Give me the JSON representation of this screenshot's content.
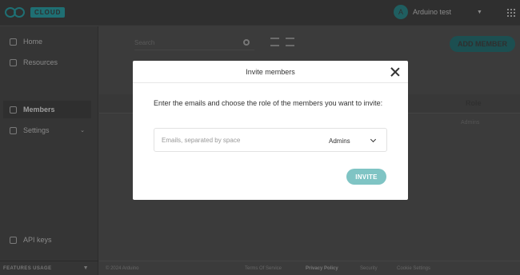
{
  "topbar": {
    "logo_text": "CLOUD",
    "user_initial": "A",
    "user_name": "Arduino test"
  },
  "sidebar": {
    "items": [
      {
        "label": "Home",
        "icon": "home-icon"
      },
      {
        "label": "Resources",
        "icon": "resources-icon"
      },
      {
        "label": "Members",
        "icon": "person-icon"
      },
      {
        "label": "Settings",
        "icon": "gear-icon"
      },
      {
        "label": "API keys",
        "icon": "key-icon"
      }
    ],
    "features_label": "FEATURES USAGE"
  },
  "main": {
    "search_placeholder": "Search",
    "add_member_label": "ADD MEMBER",
    "role_column": "Role",
    "role_value": "Admins"
  },
  "footer": {
    "copyright": "© 2024 Arduino",
    "terms": "Terms Of Service",
    "privacy": "Privacy Policy",
    "security": "Security",
    "cookie": "Cookie Settings"
  },
  "modal": {
    "title": "Invite members",
    "description": "Enter the emails and choose the role of the members you want to invite:",
    "email_placeholder": "Emails, separated by space",
    "email_value": "",
    "role_selected": "Admins",
    "invite_label": "INVITE"
  },
  "colors": {
    "accent": "#7fc4c4",
    "overlay_bg": "#3b3b3b",
    "modal_bg": "#ffffff"
  }
}
